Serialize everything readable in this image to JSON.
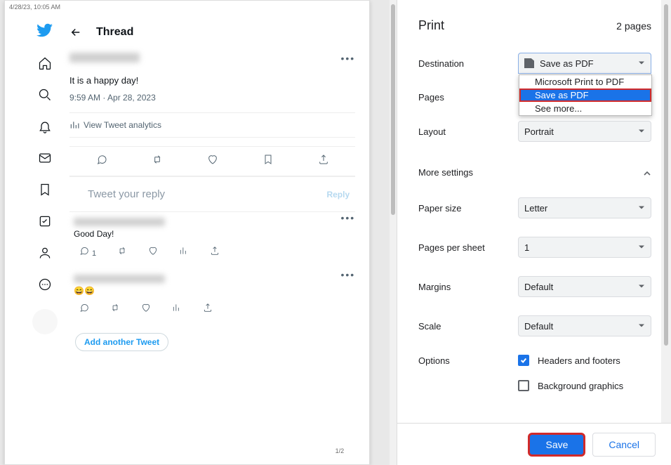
{
  "preview": {
    "timestamp": "4/28/23, 10:05 AM",
    "thread_title": "Thread",
    "tweet_text": "It is a happy day!",
    "tweet_time": "9:59 AM · Apr 28, 2023",
    "analytics": "View Tweet analytics",
    "reply_placeholder": "Tweet your reply",
    "reply_button": "Reply",
    "replies": [
      {
        "text": "Good Day!",
        "reply_count": "1"
      },
      {
        "text": "😄😄",
        "reply_count": ""
      }
    ],
    "add_another": "Add another Tweet",
    "page_counter": "1/2"
  },
  "print": {
    "title": "Print",
    "pages": "2 pages",
    "labels": {
      "destination": "Destination",
      "pages": "Pages",
      "layout": "Layout",
      "more": "More settings",
      "paper_size": "Paper size",
      "pages_per_sheet": "Pages per sheet",
      "margins": "Margins",
      "scale": "Scale",
      "options": "Options"
    },
    "destination_value": "Save as PDF",
    "destination_options": [
      "Microsoft Print to PDF",
      "Save as PDF",
      "See more..."
    ],
    "layout_value": "Portrait",
    "paper_size_value": "Letter",
    "pps_value": "1",
    "margins_value": "Default",
    "scale_value": "Default",
    "option_headers": "Headers and footers",
    "option_bg": "Background graphics",
    "save": "Save",
    "cancel": "Cancel"
  }
}
